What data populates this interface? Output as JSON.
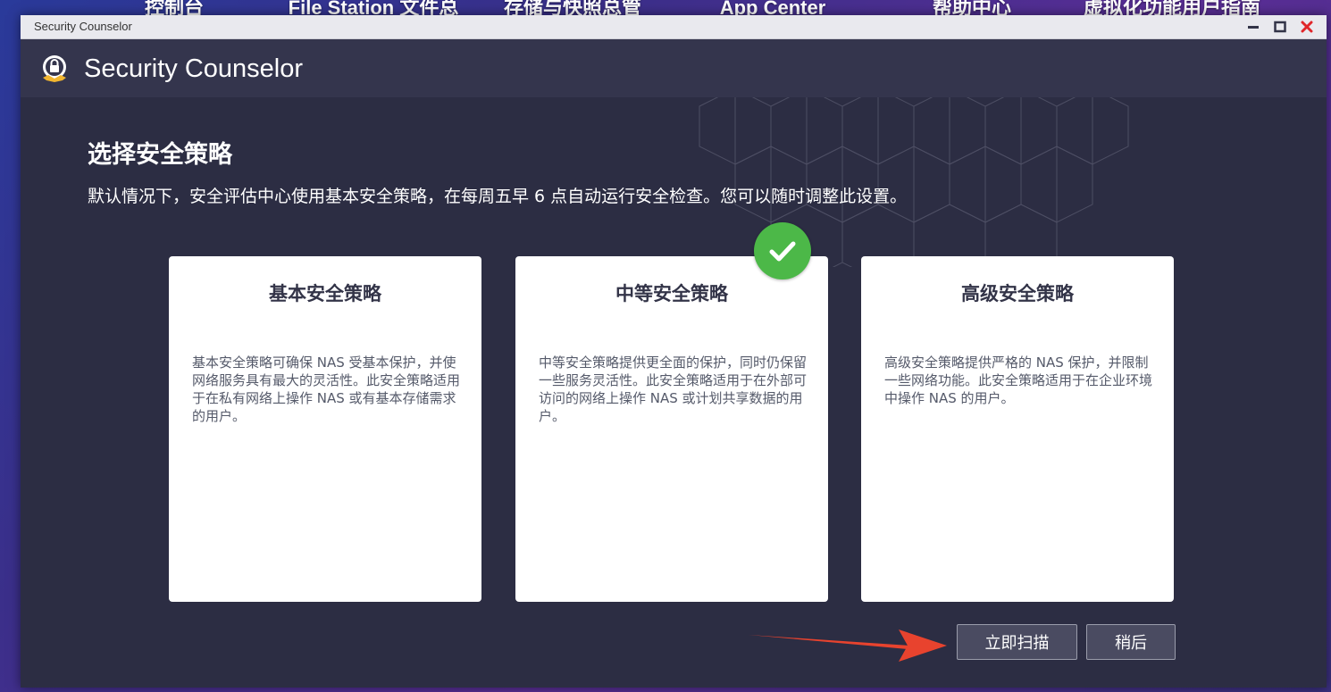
{
  "desktop": {
    "labels": [
      {
        "text": "控制台"
      },
      {
        "text": "File Station 文件总管"
      },
      {
        "text": "存储与快照总管"
      },
      {
        "text": "App Center"
      },
      {
        "text": "帮助中心"
      },
      {
        "text": "虚拟化功能用户指南"
      }
    ]
  },
  "window": {
    "title": "Security Counselor",
    "app_title": "Security Counselor"
  },
  "content": {
    "title": "选择安全策略",
    "description": "默认情况下，安全评估中心使用基本安全策略，在每周五早 6 点自动运行安全检查。您可以随时调整此设置。",
    "policies": [
      {
        "title": "基本安全策略",
        "description": "基本安全策略可确保 NAS 受基本保护，并使网络服务具有最大的灵活性。此安全策略适用于在私有网络上操作 NAS 或有基本存储需求的用户。",
        "selected": false
      },
      {
        "title": "中等安全策略",
        "description": "中等安全策略提供更全面的保护，同时仍保留一些服务灵活性。此安全策略适用于在外部可访问的网络上操作 NAS 或计划共享数据的用户。",
        "selected": true
      },
      {
        "title": "高级安全策略",
        "description": "高级安全策略提供严格的 NAS 保护，并限制一些网络功能。此安全策略适用于在企业环境中操作 NAS 的用户。",
        "selected": false
      }
    ],
    "buttons": {
      "scan_now": "立即扫描",
      "later": "稍后"
    }
  },
  "colors": {
    "window_bg": "#2c2d43",
    "header_bg": "#34354d",
    "check_green": "#4cb848",
    "arrow_red": "#e8432e"
  },
  "icons": {
    "app": "security-shield-icon",
    "selected": "check-icon",
    "minimize": "minimize-icon",
    "maximize": "maximize-icon",
    "close": "close-icon"
  }
}
